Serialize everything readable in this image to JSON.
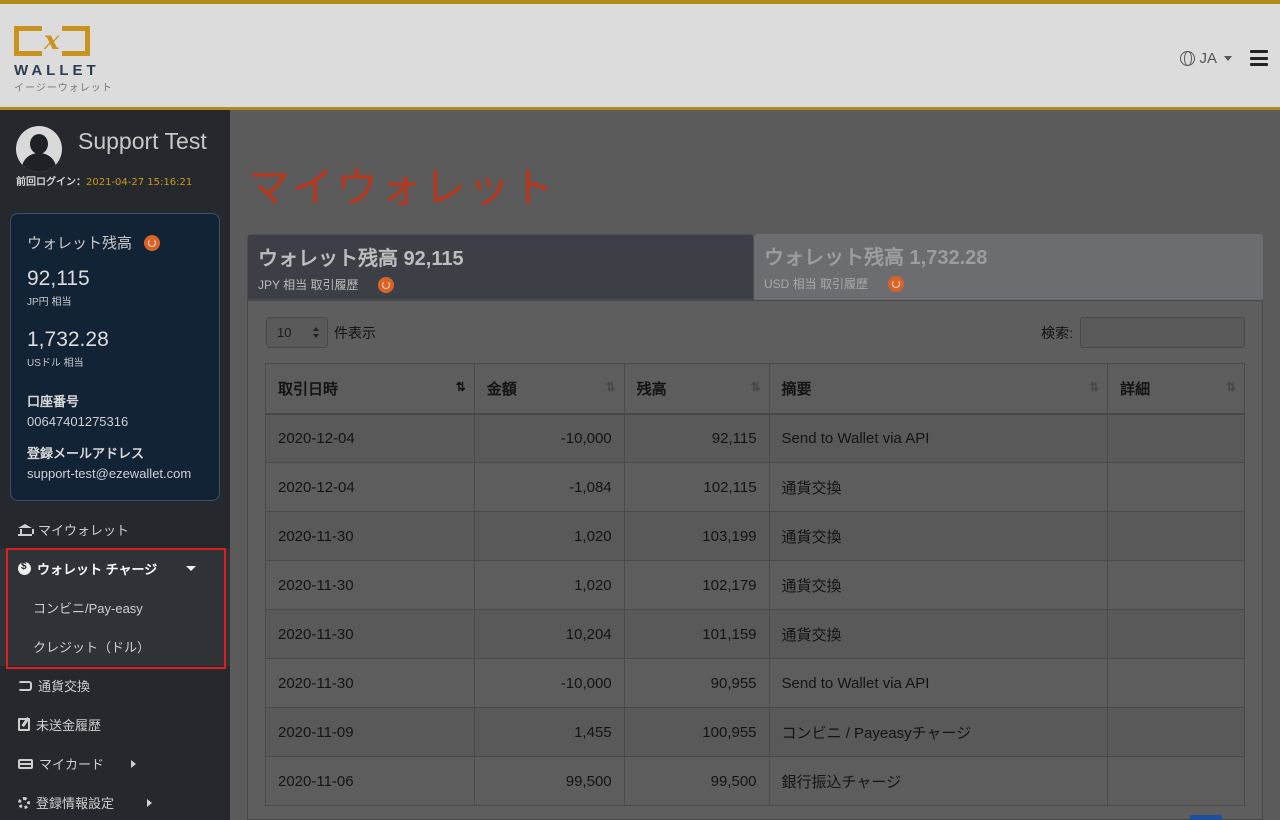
{
  "header": {
    "logo_wallet": "WALLET",
    "logo_sub": "イージーウォレット",
    "lang": "JA"
  },
  "sidebar": {
    "username": "Support Test",
    "last_login_label": "前回ログイン：",
    "last_login_value": "2021-04-27 15:16:21",
    "balance": {
      "title": "ウォレット残高",
      "jpy_amount": "92,115",
      "jpy_unit": "JP円 相当",
      "usd_amount": "1,732.28",
      "usd_unit": "USドル 相当",
      "account_label": "口座番号",
      "account_value": "00647401275316",
      "email_label": "登録メールアドレス",
      "email_value": "support-test@ezewallet.com"
    },
    "nav": {
      "my_wallet": "マイウォレット",
      "wallet_charge": "ウォレット チャージ",
      "sub_conveni": "コンビニ/Pay-easy",
      "sub_credit": "クレジット（ドル）",
      "exchange": "通貨交換",
      "unsent": "未送金履歴",
      "my_card": "マイカード",
      "settings": "登録情報設定"
    }
  },
  "main": {
    "title": "マイウォレット",
    "tabs": [
      {
        "title": "ウォレット残高 92,115",
        "sub": "JPY 相当 取引履歴"
      },
      {
        "title": "ウォレット残高 1,732.28",
        "sub": "USD 相当 取引履歴"
      }
    ],
    "length_value": "10",
    "length_label": "件表示",
    "search_label": "検索:",
    "columns": [
      "取引日時",
      "金額",
      "残高",
      "摘要",
      "詳細"
    ],
    "rows": [
      [
        "2020-12-04",
        "-10,000",
        "92,115",
        "Send to Wallet via API",
        ""
      ],
      [
        "2020-12-04",
        "-1,084",
        "102,115",
        "通貨交換",
        ""
      ],
      [
        "2020-11-30",
        "1,020",
        "103,199",
        "通貨交換",
        ""
      ],
      [
        "2020-11-30",
        "1,020",
        "102,179",
        "通貨交換",
        ""
      ],
      [
        "2020-11-30",
        "10,204",
        "101,159",
        "通貨交換",
        ""
      ],
      [
        "2020-11-30",
        "-10,000",
        "90,955",
        "Send to Wallet via API",
        ""
      ],
      [
        "2020-11-09",
        "1,455",
        "100,955",
        "コンビニ / Payeasyチャージ",
        ""
      ],
      [
        "2020-11-06",
        "99,500",
        "99,500",
        "銀行振込チャージ",
        ""
      ]
    ]
  },
  "colors": {
    "accent_gold": "#b08a1a",
    "title_red": "#b8361b",
    "highlight_red": "#e01e1e",
    "refresh_orange": "#d9642a"
  }
}
